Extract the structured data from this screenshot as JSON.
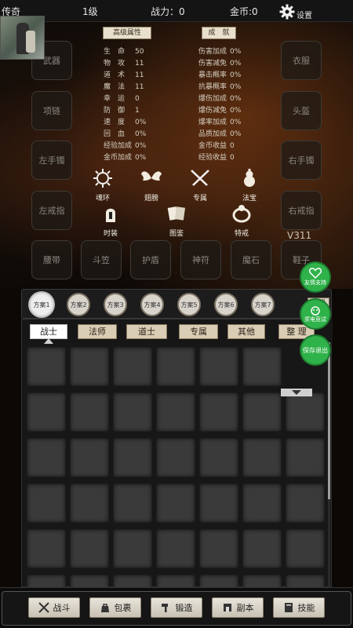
{
  "topbar": {
    "title": "传奇",
    "level": "1级",
    "power": "战力：0",
    "gold": "金币:0",
    "settings": "设置"
  },
  "buttons": {
    "advanced": "高级属性",
    "achievement": "成　就"
  },
  "equip_left": [
    "武器",
    "项链",
    "左手镯",
    "左戒指"
  ],
  "equip_right": [
    "衣服",
    "头盔",
    "右手镯",
    "右戒指"
  ],
  "equip_bottom": [
    "腰带",
    "斗笠",
    "护盾",
    "神符",
    "魔石",
    "鞋子"
  ],
  "stats_left": [
    {
      "k": "生　命",
      "v": "50"
    },
    {
      "k": "物　攻",
      "v": "11"
    },
    {
      "k": "道　术",
      "v": "11"
    },
    {
      "k": "魔　法",
      "v": "11"
    },
    {
      "k": "幸　运",
      "v": "0"
    },
    {
      "k": "防　御",
      "v": "1"
    },
    {
      "k": "速　度",
      "v": "0%"
    },
    {
      "k": "回　血",
      "v": "0%"
    },
    {
      "k": "经验加成",
      "v": "0%"
    },
    {
      "k": "金币加成",
      "v": "0%"
    }
  ],
  "stats_right": [
    {
      "k": "伤害加成",
      "v": "0%"
    },
    {
      "k": "伤害减免",
      "v": "0%"
    },
    {
      "k": "暴击概率",
      "v": "0%"
    },
    {
      "k": "抗暴概率",
      "v": "0%"
    },
    {
      "k": "爆伤加成",
      "v": "0%"
    },
    {
      "k": "爆伤减免",
      "v": "0%"
    },
    {
      "k": "爆率加成",
      "v": "0%"
    },
    {
      "k": "品质加成",
      "v": "0%"
    },
    {
      "k": "金币收益",
      "v": "0"
    },
    {
      "k": "经验收益",
      "v": "0"
    }
  ],
  "categories": [
    "魂环",
    "翅膀",
    "专属",
    "法宝",
    "时装",
    "图鉴",
    "特戒"
  ],
  "version": "V311",
  "side_buttons": {
    "friend": "友情支持",
    "trophy": "奖电竞试",
    "save": "保存退出"
  },
  "schemes": [
    "方案1",
    "方案2",
    "方案3",
    "方案4",
    "方案5",
    "方案6",
    "方案7"
  ],
  "scheme_setting": "设置",
  "tabs": [
    "战士",
    "法师",
    "道士",
    "专属",
    "其他"
  ],
  "sort_label": "整 理",
  "nav": [
    "战斗",
    "包裹",
    "锻造",
    "副本",
    "技能"
  ],
  "colors": {
    "accent_green": "#2fb24a",
    "tab_bg": "#d9cdb5",
    "slot_bg": "#3a3a3a"
  }
}
